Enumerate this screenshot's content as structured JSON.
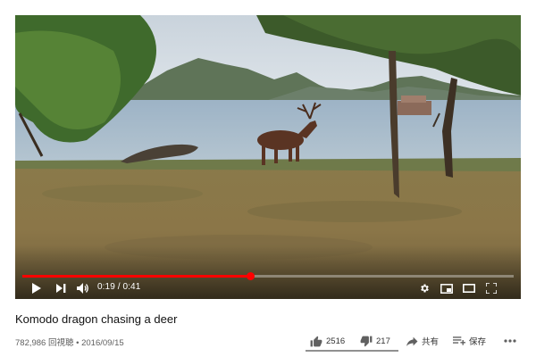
{
  "video": {
    "current_time": "0:19",
    "duration": "0:41",
    "time_separator": " / ",
    "progress_fraction": 0.463,
    "accent_color": "#ff0000"
  },
  "controls": {
    "play_icon": "play-icon",
    "next_icon": "next-icon",
    "volume_icon": "volume-icon",
    "settings_icon": "gear-icon",
    "miniplayer_icon": "miniplayer-icon",
    "theater_icon": "theater-icon",
    "fullscreen_icon": "fullscreen-icon"
  },
  "info": {
    "title": "Komodo dragon chasing a deer",
    "views": "782,986 回視聴",
    "bullet": " • ",
    "date": "2016/09/15"
  },
  "actions": {
    "like_count": "2516",
    "dislike_count": "217",
    "share_label": "共有",
    "save_label": "保存"
  }
}
